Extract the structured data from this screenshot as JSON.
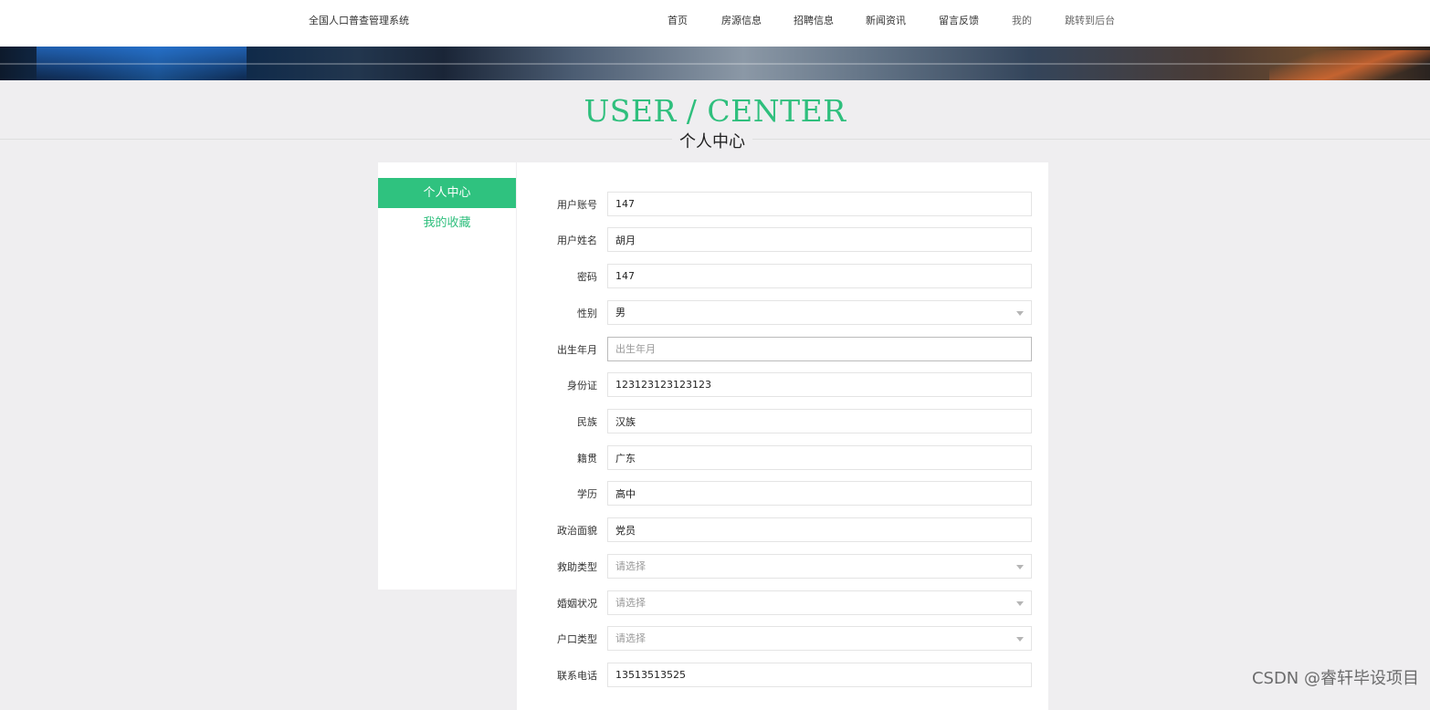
{
  "header": {
    "site_title": "全国人口普查管理系统",
    "nav": [
      {
        "label": "首页"
      },
      {
        "label": "房源信息"
      },
      {
        "label": "招聘信息"
      },
      {
        "label": "新闻资讯"
      },
      {
        "label": "留言反馈"
      },
      {
        "label": "我的"
      },
      {
        "label": "跳转到后台"
      }
    ]
  },
  "page_heading": {
    "en": "USER / CENTER",
    "cn": "个人中心"
  },
  "sidebar": {
    "items": [
      {
        "label": "个人中心",
        "active": true
      },
      {
        "label": "我的收藏",
        "active": false
      }
    ],
    "active_color": "#2fc27f"
  },
  "form": {
    "fields": [
      {
        "label": "用户账号",
        "value": "147",
        "type": "text"
      },
      {
        "label": "用户姓名",
        "value": "胡月",
        "type": "text"
      },
      {
        "label": "密码",
        "value": "147",
        "type": "text"
      },
      {
        "label": "性别",
        "value": "男",
        "type": "select"
      },
      {
        "label": "出生年月",
        "value": "",
        "placeholder": "出生年月",
        "type": "date"
      },
      {
        "label": "身份证",
        "value": "123123123123123",
        "type": "text"
      },
      {
        "label": "民族",
        "value": "汉族",
        "type": "text"
      },
      {
        "label": "籍贯",
        "value": "广东",
        "type": "text"
      },
      {
        "label": "学历",
        "value": "高中",
        "type": "text"
      },
      {
        "label": "政治面貌",
        "value": "党员",
        "type": "text"
      },
      {
        "label": "救助类型",
        "value": "",
        "placeholder": "请选择",
        "type": "select"
      },
      {
        "label": "婚姻状况",
        "value": "",
        "placeholder": "请选择",
        "type": "select"
      },
      {
        "label": "户口类型",
        "value": "",
        "placeholder": "请选择",
        "type": "select"
      },
      {
        "label": "联系电话",
        "value": "13513513525",
        "type": "text"
      }
    ]
  },
  "watermark": "CSDN @睿轩毕设项目",
  "colors": {
    "accent": "#2fbf7d",
    "background": "#efeef0"
  }
}
